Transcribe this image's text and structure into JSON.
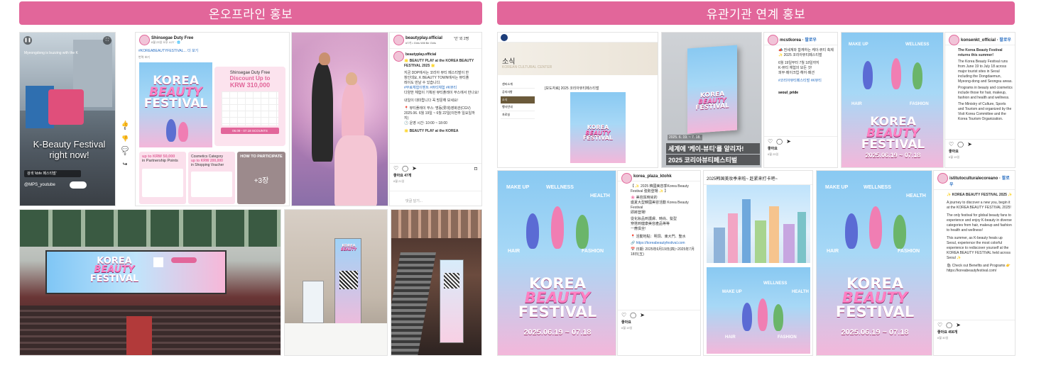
{
  "headers": {
    "left": "온오프라인 홍보",
    "right": "유관기관 연계 홍보"
  },
  "poster": {
    "korea": "KOREA",
    "beauty": "BEAUTY",
    "festival": "FESTIVAL",
    "dates": "2025.06.19 ~ 07.18",
    "cats": [
      "MAKE UP",
      "WELLNESS",
      "HEALTH",
      "HAIR",
      "FASHION"
    ]
  },
  "video": {
    "caption": "K-Beauty Festival right now!",
    "overlay_top": "Myeongdong is buzzing with the K",
    "search": "검색 'kbfe 페스티벌'",
    "user": "@MPS_youtube",
    "side_counts": [
      "6",
      "0"
    ]
  },
  "shinsegae": {
    "account": "Shinsegae Duty Free",
    "sub": "6월 23일 오후 4:27 · 🌐",
    "tag": "#KOREABEAUTYFESTIVAL... 더 보기",
    "link": "번역 보기",
    "discount_title": "Shinsegae Duty Free",
    "discount_line": "Discount Up to",
    "discount_amount": "KRW 310,000",
    "dates_badge": "06.09 - 07.18 SCOUNTS",
    "points_title": "up to KRW 50,000",
    "points_sub": "in Partnership Points",
    "voucher_title": "Cosmetics Category",
    "voucher_line": "up to KRW 200,000",
    "voucher_sub": "in Shopping Voucher",
    "howto": "HOW TO PARTICIPATE",
    "more": "+3장"
  },
  "beautyplay": {
    "account": "beautyplay.official",
    "meta": "'인' 외 2명",
    "music": "#7가 • Girls Will Be Girls",
    "caption_title": "🌟 BEAUTY PLAY at the KOREA BEAUTY FESTIVAL 2025 🌟",
    "lines": [
      "지금 DDP에서는 코리아 뷰티 페스티벌이 한",
      "창인데요, K BEAUTY TOWN에서는 뷰티플",
      "레이도 만날 수 있습니다.",
      "#무료체험이벤트 #뷰티체험 #K뷰티",
      "다양한 체험이 기획된 뷰티플레이 부스에서 만나요!",
      "내일이 대미랍니다 꼭 방문해 보세요!",
      "📍 뷰티플레이 부스: 명동(롯데)영화관(CGV)",
      "2025.06. 6월 19일 ~ 6월 22일(이번주 일요일까지)",
      "🕐 운영 시간: 10:00 ~ 18:00",
      "🌟 BEAUTY PLAY at the KOREA"
    ],
    "likes": "좋아요 47개",
    "date": "6월 21일",
    "comment": "댓글 달기..."
  },
  "kcc": {
    "title": "소식",
    "subtitle": "KOREAN CULTURAL CENTER",
    "post_title": "[보도자료] 2025 코리아뷰티페스티벌",
    "menu": [
      "센터소개",
      "공지사항",
      "소식",
      "행사안내",
      "자료실"
    ]
  },
  "seoul_poster": {
    "dates": "2025. 6. 19. ~ 7. 18.",
    "line1": "세계에 '케이-뷰티'를 알리자!",
    "line2": "2025 코리아뷰티페스티벌"
  },
  "mcst": {
    "account": "mcstkorea",
    "follow": "팔로우",
    "lines": [
      "📣 전세계와 함께하는 케이-뷰티 축제",
      "✨ 2025 코리아뷰티페스티벌",
      "6월 19일부터 7월 18일까지",
      "K-뷰티 체험의 모든 것!",
      "피부·메이크업·헤어·패션",
      "#코리아뷰티페스티벌 #K뷰티"
    ],
    "reply_user": "seoul_pride",
    "likes": "좋아요",
    "date": "6월 25일"
  },
  "konsenkt": {
    "account": "konsenkt_official",
    "follow": "팔로우",
    "lines": [
      "The Korea Beauty Festival returns this summer!",
      "The Korea Beauty Festival runs from June 19 to July 18 across major tourist sites in Seoul including the Dongdaemun, Myeong-dong and Seongsu areas.",
      "Programs in beauty and cosmetics include those for hair, makeup, fashion and health and wellness.",
      "The Ministry of Culture, Sports and Tourism and organized by the Visit Korea Committee and the Korea Tourism Organization."
    ],
    "likes": "좋아요",
    "date": "6월 19일"
  },
  "weibo": {
    "account": "korea_plaza_ktohk",
    "lines": [
      "【 ✨ 2025 韓國美容季Korea Beauty Festival 強勢登場 ✨ 】",
      "🌸 美容與時尚的",
      "盛夏大型韓國美容活動 Korea Beauty Festival",
      "即將登場!",
      "從化妝品到護膚、時尚、髮型",
      "穿搭到健康美容產品等等",
      "一應俱全!",
      "📍 活動地點：明洞、東大門、聖水",
      "🔗 https://koreabeautyfestival.com",
      "📅 日期: 2025年6月19日(四)~2025年7月18日(五)"
    ],
    "likes": "좋아요",
    "date": "6월 19일"
  },
  "chinese_post": {
    "title": "2025韩国美妆季来啦~ 赶紧来打卡吧~"
  },
  "italian": {
    "account": "istitutoculturalecoreano",
    "follow": "팔로우",
    "lines": [
      "✨ KOREA BEAUTY FESTIVAL 2025 ✨",
      "A journey to discover a new you, begin it at the KOREA BEAUTY FESTIVAL 2025!",
      "The only festival for global beauty fans to experience and enjoy K-beauty in diverse categories from hair, makeup and fashion to health and wellness!",
      "This summer, as K-beauty heats up Seoul, experience the most colorful experience to rediscover yourself at the KOREA BEAUTY FESTIVAL held across Seoul ✨",
      "🛍 Check out Benefits and Programs 👉 https://koreabeautyfestival.com/"
    ],
    "likes": "좋아요 456개",
    "date": "6월 30일"
  },
  "colors": {
    "accent": "#e2669a",
    "poster_sky": "#89c9f2",
    "poster_pink": "#f3b7da"
  }
}
